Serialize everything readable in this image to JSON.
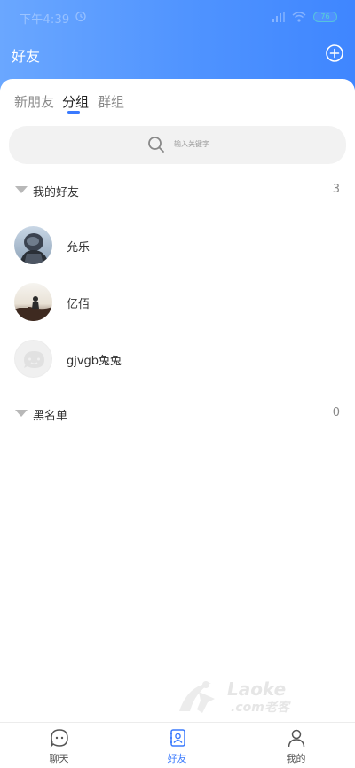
{
  "status_bar": {
    "time": "下午4:39",
    "battery": "76"
  },
  "header": {
    "title": "好友",
    "add_icon": "plus-circle-icon"
  },
  "tabs": [
    {
      "label": "新朋友",
      "active": false
    },
    {
      "label": "分组",
      "active": true
    },
    {
      "label": "群组",
      "active": false
    }
  ],
  "search": {
    "placeholder": "输入关键字"
  },
  "groups": [
    {
      "name": "我的好友",
      "count": "3",
      "friends": [
        {
          "name": "允乐"
        },
        {
          "name": "亿佰"
        },
        {
          "name": "gjvgb兔兔"
        }
      ]
    },
    {
      "name": "黑名单",
      "count": "0",
      "friends": []
    }
  ],
  "bottom_nav": [
    {
      "label": "聊天",
      "icon": "chat-icon",
      "active": false
    },
    {
      "label": "好友",
      "icon": "contacts-icon",
      "active": true
    },
    {
      "label": "我的",
      "icon": "person-icon",
      "active": false
    }
  ],
  "watermark": {
    "line1": "Laoke",
    "line2": ".com老客"
  },
  "colors": {
    "accent": "#3a7afe",
    "header_gradient_start": "#6aa7ff",
    "header_gradient_end": "#3f86ff"
  }
}
